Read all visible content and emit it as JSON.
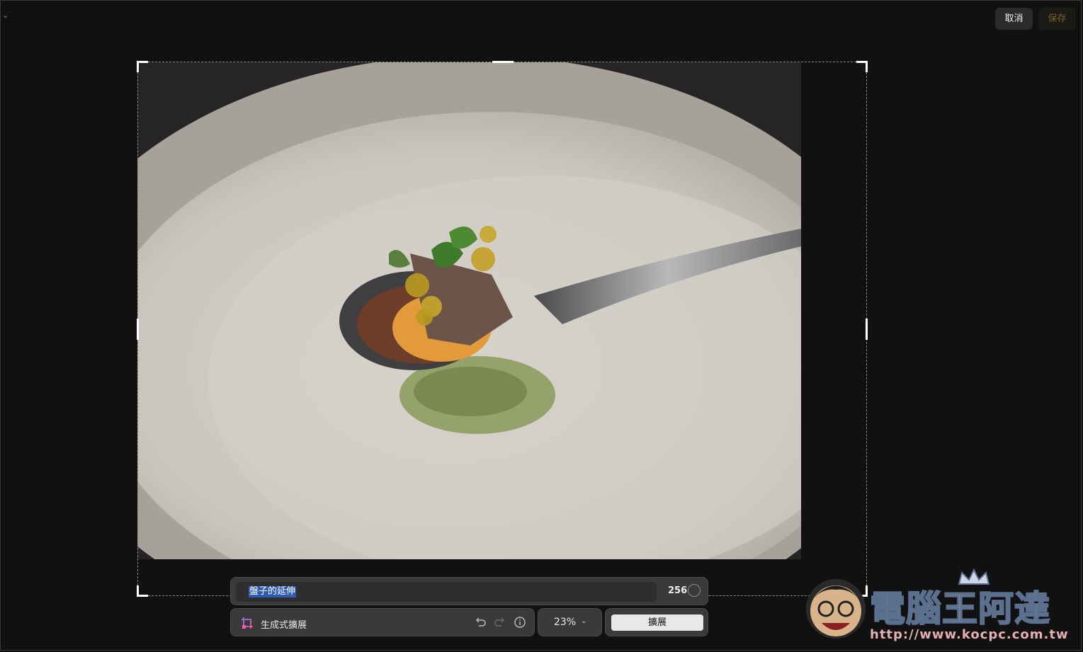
{
  "header": {
    "cancel_label": "取消",
    "save_label": "保存"
  },
  "prompt": {
    "text": "盤子的延伸",
    "char_count": "256"
  },
  "toolbar": {
    "tool_label": "生成式擴展",
    "zoom_label": "23%",
    "expand_label": "擴展"
  },
  "watermark": {
    "title": "電腦王阿達",
    "url": "http://www.kocpc.com.tw"
  },
  "icons": {
    "chevron": "chevron-down-icon",
    "generative": "generative-expand-icon",
    "undo": "undo-icon",
    "redo": "redo-icon",
    "info": "info-icon"
  },
  "colors": {
    "background": "#111111",
    "selection": "#2f5bb4",
    "save_text": "#7a5f2e"
  }
}
